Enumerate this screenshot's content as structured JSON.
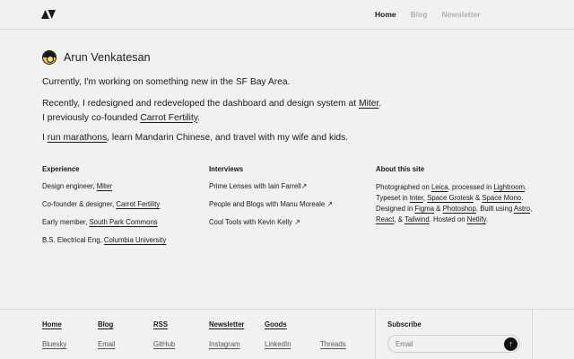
{
  "nav": {
    "home": "Home",
    "blog": "Blog",
    "newsletter": "Newsletter"
  },
  "intro": {
    "name": "Arun Venkatesan",
    "p1": "Currently, I'm working on something new in the SF Bay Area.",
    "p2_a": "Recently, I redesigned and redeveloped the dashboard and design system at ",
    "p2_link1": "Miter",
    "p2_b": ". I previously co-founded ",
    "p2_link2": "Carrot Fertility",
    "p2_c": ".",
    "p3_a": "I ",
    "p3_link": "run marathons",
    "p3_b": ", learn Mandarin Chinese, and travel with my wife and kids."
  },
  "experience": {
    "title": "Experience",
    "items": [
      {
        "text": "Design engineer, ",
        "link": "Miter"
      },
      {
        "text": "Co-founder & designer, ",
        "link": "Carrot Fertility"
      },
      {
        "text": "Early member, ",
        "link": "South Park Commons"
      },
      {
        "text": "B.S. Electrical Eng, ",
        "link": "Columbia University"
      }
    ]
  },
  "interviews": {
    "title": "Interviews",
    "items": [
      "Prime Lenses with Iain Farrell",
      "People and Blogs with Manu Moreale",
      "Cool Tools with Kevin Kelly"
    ],
    "arrow": "↗"
  },
  "about": {
    "title": "About this site",
    "t1": "Photographed on ",
    "l_leica": "Leica",
    "t2": ", processed in ",
    "l_lightroom": "Lightroom",
    "t3": ". Typeset in ",
    "l_inter": "Inter",
    "t4": ", ",
    "l_grotesk": "Space Grotesk",
    "t5": " & ",
    "l_mono": "Space Mono",
    "t6": ". Designed in ",
    "l_figma": "Figma",
    "t7": " & ",
    "l_photoshop": "Photoshop",
    "t8": ". Built using ",
    "l_astro": "Astro",
    "t9": ", ",
    "l_react": "React",
    "t10": ", & ",
    "l_tailwind": "Tailwind",
    "t11": ". Hosted on ",
    "l_netlify": "Netlify",
    "t12": "."
  },
  "footer": {
    "home": "Home",
    "blog": "Blog",
    "rss": "RSS",
    "newsletter": "Newsletter",
    "goods": "Goods",
    "bluesky": "Bluesky",
    "email": "Email",
    "github": "GitHub",
    "instagram": "Instagram",
    "linkedin": "LinkedIn",
    "threads": "Threads",
    "subscribe": "Subscribe",
    "email_placeholder": "Email",
    "send_arrow": "↑"
  }
}
